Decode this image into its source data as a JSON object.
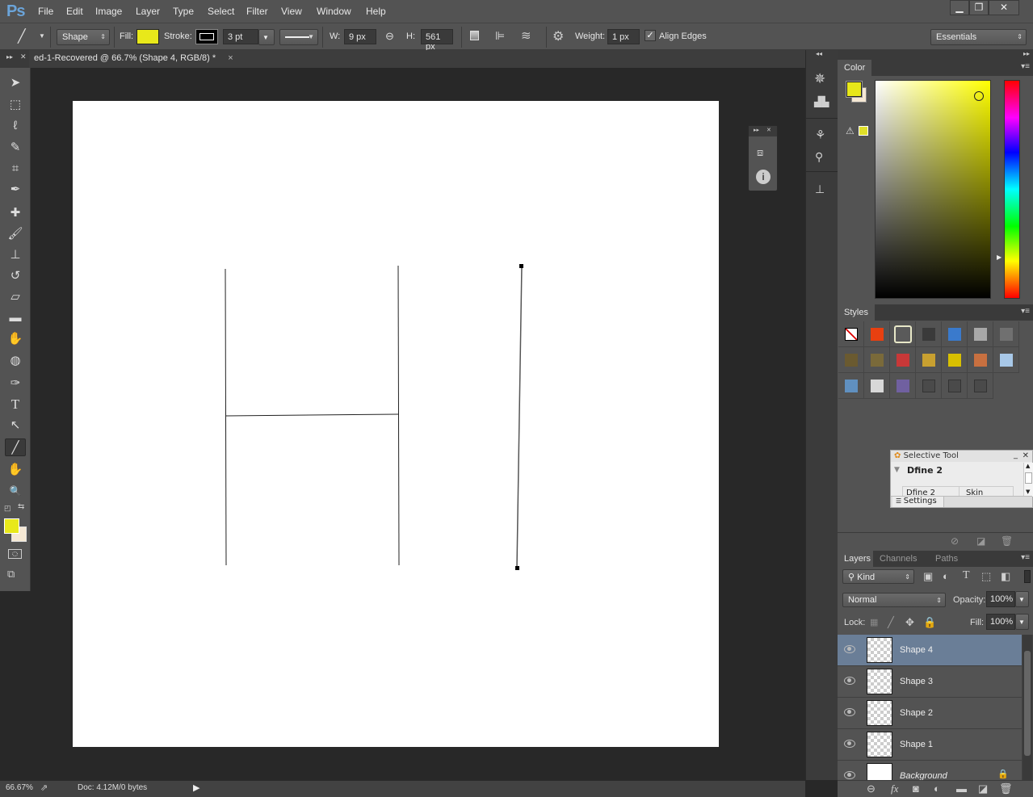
{
  "app": {
    "logo": "Ps"
  },
  "menu": [
    "File",
    "Edit",
    "Image",
    "Layer",
    "Type",
    "Select",
    "Filter",
    "View",
    "Window",
    "Help"
  ],
  "window_controls": {
    "minimize": "▁",
    "restore": "❐",
    "close": "✕"
  },
  "options_bar": {
    "tool_mode": "Shape",
    "fill_label": "Fill:",
    "fill_color": "#e8e81a",
    "stroke_label": "Stroke:",
    "stroke_width": "3 pt",
    "w_label": "W:",
    "w_value": "9 px",
    "h_label": "H:",
    "h_value": "561 px",
    "weight_label": "Weight:",
    "weight_value": "1 px",
    "align_edges_label": "Align Edges",
    "align_edges_checked": true,
    "workspace": "Essentials"
  },
  "document_tab": {
    "title": "ed-1-Recovered @ 66.7% (Shape 4, RGB/8) *",
    "close": "×"
  },
  "canvas": {
    "background": "#ffffff",
    "shapes": [
      {
        "name": "Shape 1",
        "type": "line"
      },
      {
        "name": "Shape 2",
        "type": "line"
      },
      {
        "name": "Shape 3",
        "type": "line"
      },
      {
        "name": "Shape 4",
        "type": "line",
        "selected": true
      }
    ]
  },
  "tools": [
    {
      "name": "move-tool",
      "glyph": "➤"
    },
    {
      "name": "marquee-tool",
      "glyph": "⬚"
    },
    {
      "name": "lasso-tool",
      "glyph": "ℓ"
    },
    {
      "name": "quick-selection-tool",
      "glyph": "✎"
    },
    {
      "name": "crop-tool",
      "glyph": "⌗"
    },
    {
      "name": "eyedropper-tool",
      "glyph": "✒"
    },
    {
      "name": "healing-brush-tool",
      "glyph": "✚"
    },
    {
      "name": "brush-tool",
      "glyph": "🖌"
    },
    {
      "name": "clone-stamp-tool",
      "glyph": "⊥"
    },
    {
      "name": "history-brush-tool",
      "glyph": "↺"
    },
    {
      "name": "eraser-tool",
      "glyph": "▱"
    },
    {
      "name": "gradient-tool",
      "glyph": "▬"
    },
    {
      "name": "blur-tool",
      "glyph": "✋"
    },
    {
      "name": "sponge-tool",
      "glyph": "◍"
    },
    {
      "name": "pen-tool",
      "glyph": "✑"
    },
    {
      "name": "type-tool",
      "glyph": "T"
    },
    {
      "name": "path-selection-tool",
      "glyph": "↖"
    },
    {
      "name": "line-tool",
      "glyph": "╱",
      "active": true
    },
    {
      "name": "hand-tool",
      "glyph": "✋"
    },
    {
      "name": "zoom-tool",
      "glyph": "🔍"
    }
  ],
  "colors": {
    "foreground": "#e8e81a",
    "background": "#f5e8d4"
  },
  "status_bar": {
    "zoom": "66.67%",
    "doc_info": "Doc: 4.12M/0 bytes"
  },
  "color_panel": {
    "tab": "Color",
    "fg": "#e8e81a",
    "bg": "#f5e8d4",
    "gamut_swatch": "#e0e02a",
    "hue": "#ffff00"
  },
  "styles_panel": {
    "tab": "Styles",
    "swatches": [
      "#ffffff",
      "#e84010",
      "#5a5a5a",
      "#3a3a3a",
      "#3a7acc",
      "#a8a8a8",
      "#707070",
      "#6a5a30",
      "#7a6a3a",
      "#c83838",
      "#c8a030",
      "#d8c000",
      "#c87040",
      "#a8c8e8",
      "#6090c0",
      "#d8d8d8",
      "#7060a0",
      "#4a4a4a",
      "#4a4a4a",
      "#4a4a4a"
    ]
  },
  "selective_tool": {
    "title": "Selective Tool",
    "section": "Dfine 2",
    "col1": "Dfine 2",
    "col2": "Skin",
    "settings": "Settings"
  },
  "layers_panel": {
    "tabs": [
      "Layers",
      "Channels",
      "Paths"
    ],
    "filter": "Kind",
    "blend_mode": "Normal",
    "opacity_label": "Opacity:",
    "opacity": "100%",
    "lock_label": "Lock:",
    "fill_label": "Fill:",
    "fill": "100%",
    "layers": [
      {
        "name": "Shape 4",
        "selected": true
      },
      {
        "name": "Shape 3"
      },
      {
        "name": "Shape 2"
      },
      {
        "name": "Shape 1"
      },
      {
        "name": "Background",
        "locked": true
      }
    ]
  }
}
